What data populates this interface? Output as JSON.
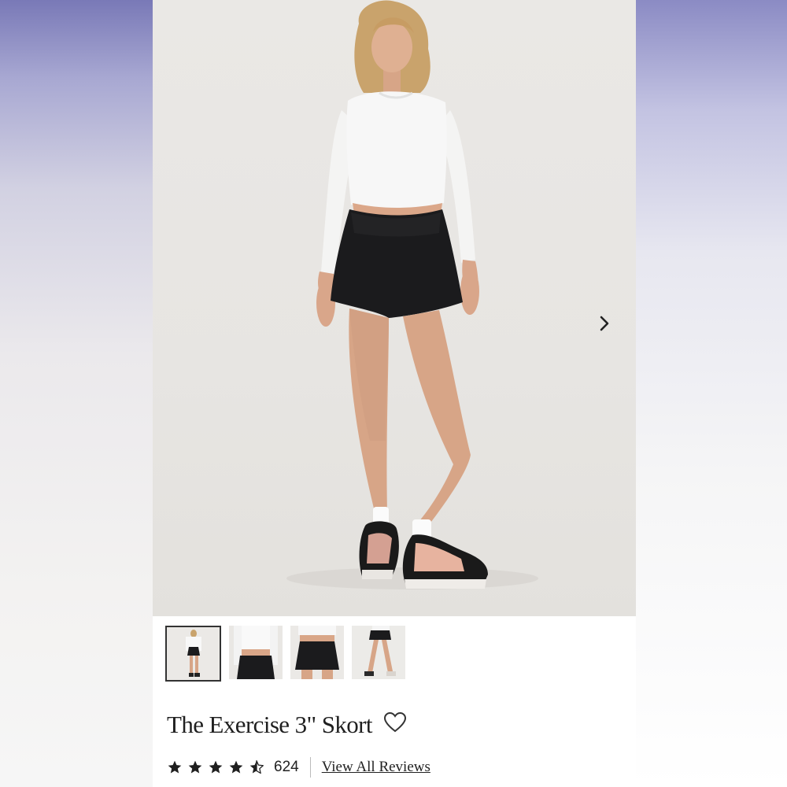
{
  "product": {
    "title": "The Exercise 3\" Skort",
    "rating": 4.5,
    "rating_max": 5,
    "review_count": "624",
    "reviews_link": "View All Reviews"
  },
  "gallery": {
    "thumbnails": [
      {
        "name": "full-body-front"
      },
      {
        "name": "top-closeup"
      },
      {
        "name": "skort-front-closeup"
      },
      {
        "name": "skort-walking-side"
      }
    ],
    "active_index": 0
  },
  "icons": {
    "next": "chevron-right-icon",
    "favorite": "heart-icon",
    "star": "star-icon"
  },
  "colors": {
    "skort": "#1b1b1d",
    "top": "#f7f7f7",
    "skin": "#d9a88a",
    "text": "#1f1f1f"
  }
}
